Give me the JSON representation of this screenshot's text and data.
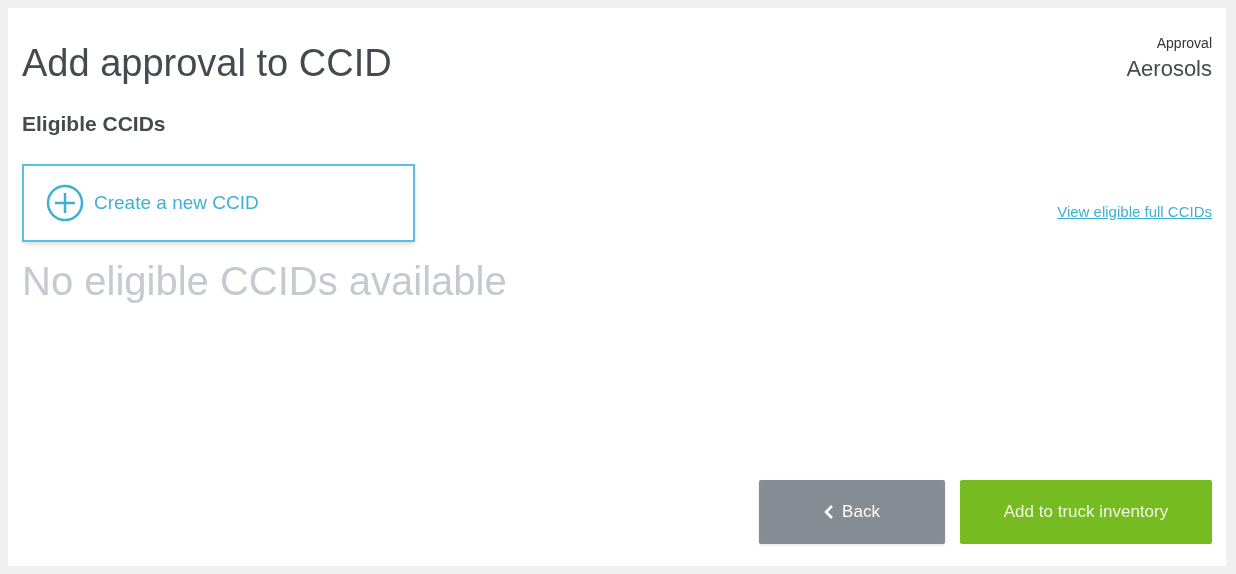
{
  "header": {
    "title": "Add approval to CCID",
    "approval_label": "Approval",
    "approval_value": "Aerosols"
  },
  "section": {
    "heading": "Eligible CCIDs",
    "create_button": "Create a new CCID",
    "view_link": "View eligible full CCIDs",
    "empty_message": "No eligible CCIDs available"
  },
  "footer": {
    "back_button": "Back",
    "submit_button": "Add to truck inventory"
  }
}
